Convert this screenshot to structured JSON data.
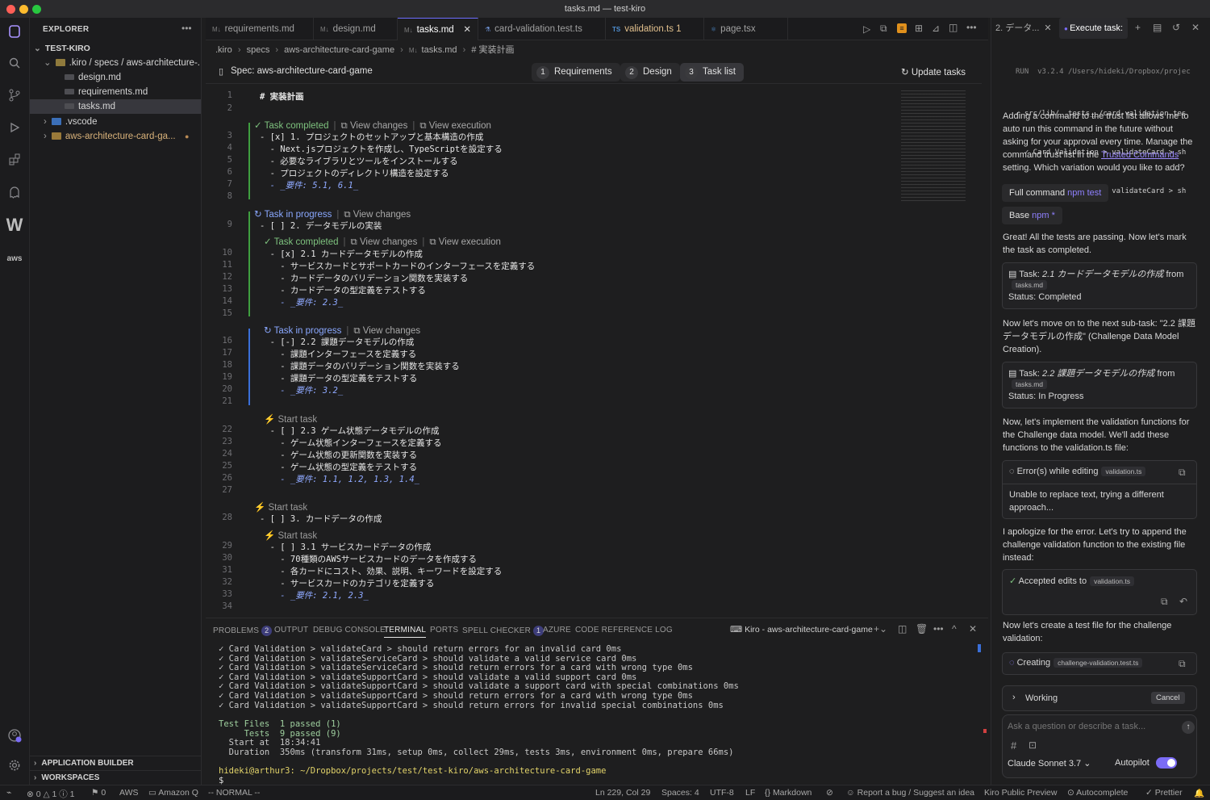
{
  "window": {
    "title": "tasks.md — test-kiro"
  },
  "explorer": {
    "header": "EXPLORER",
    "root": "TEST-KIRO",
    "items": [
      {
        "label": ".kiro / specs / aws-architecture-..."
      },
      {
        "label": "design.md"
      },
      {
        "label": "requirements.md"
      },
      {
        "label": "tasks.md"
      },
      {
        "label": ".vscode"
      },
      {
        "label": "aws-architecture-card-ga..."
      }
    ],
    "sections": [
      "APPLICATION BUILDER",
      "WORKSPACES"
    ]
  },
  "tabs": [
    {
      "label": "requirements.md"
    },
    {
      "label": "design.md"
    },
    {
      "label": "tasks.md"
    },
    {
      "label": "card-validation.test.ts"
    },
    {
      "label": "validation.ts 1"
    },
    {
      "label": "page.tsx"
    }
  ],
  "breadcrumb": [
    ".kiro",
    "specs",
    "aws-architecture-card-game",
    "tasks.md",
    "# 実装計画"
  ],
  "spec": {
    "title": "Spec: aws-architecture-card-game",
    "steps": [
      {
        "n": "1",
        "label": "Requirements"
      },
      {
        "n": "2",
        "label": "Design"
      },
      {
        "n": "3",
        "label": "Task list"
      }
    ],
    "update": "Update tasks"
  },
  "lens": {
    "completed": "Task completed",
    "in_progress": "Task in progress",
    "start": "Start task",
    "view_changes": "View changes",
    "view_execution": "View execution"
  },
  "code": [
    {
      "n": "1",
      "t": "# 実装計画"
    },
    {
      "n": "2",
      "t": ""
    },
    {
      "n": "3",
      "t": "- [x] 1. プロジェクトのセットアップと基本構造の作成"
    },
    {
      "n": "4",
      "t": "  - Next.jsプロジェクトを作成し、TypeScriptを設定する"
    },
    {
      "n": "5",
      "t": "  - 必要なライブラリとツールをインストールする"
    },
    {
      "n": "6",
      "t": "  - プロジェクトのディレクトリ構造を設定する"
    },
    {
      "n": "7",
      "t": "  - _要件: 5.1, 6.1_"
    },
    {
      "n": "8",
      "t": ""
    },
    {
      "n": "9",
      "t": "- [ ] 2. データモデルの実装"
    },
    {
      "n": "10",
      "t": "  - [x] 2.1 カードデータモデルの作成"
    },
    {
      "n": "11",
      "t": "    - サービスカードとサポートカードのインターフェースを定義する"
    },
    {
      "n": "12",
      "t": "    - カードデータのバリデーション関数を実装する"
    },
    {
      "n": "13",
      "t": "    - カードデータの型定義をテストする"
    },
    {
      "n": "14",
      "t": "    - _要件: 2.3_"
    },
    {
      "n": "15",
      "t": ""
    },
    {
      "n": "16",
      "t": "  - [-] 2.2 課題データモデルの作成"
    },
    {
      "n": "17",
      "t": "    - 課題インターフェースを定義する"
    },
    {
      "n": "18",
      "t": "    - 課題データのバリデーション関数を実装する"
    },
    {
      "n": "19",
      "t": "    - 課題データの型定義をテストする"
    },
    {
      "n": "20",
      "t": "    - _要件: 3.2_"
    },
    {
      "n": "21",
      "t": ""
    },
    {
      "n": "22",
      "t": "  - [ ] 2.3 ゲーム状態データモデルの作成"
    },
    {
      "n": "23",
      "t": "    - ゲーム状態インターフェースを定義する"
    },
    {
      "n": "24",
      "t": "    - ゲーム状態の更新関数を実装する"
    },
    {
      "n": "25",
      "t": "    - ゲーム状態の型定義をテストする"
    },
    {
      "n": "26",
      "t": "    - _要件: 1.1, 1.2, 1.3, 1.4_"
    },
    {
      "n": "27",
      "t": ""
    },
    {
      "n": "28",
      "t": "- [ ] 3. カードデータの作成"
    },
    {
      "n": "29",
      "t": "  - [ ] 3.1 サービスカードデータの作成"
    },
    {
      "n": "30",
      "t": "    - 70種類のAWSサービスカードのデータを作成する"
    },
    {
      "n": "31",
      "t": "    - 各カードにコスト、効果、説明、キーワードを設定する"
    },
    {
      "n": "32",
      "t": "    - サービスカードのカテゴリを定義する"
    },
    {
      "n": "33",
      "t": "    - _要件: 2.1, 2.3_"
    },
    {
      "n": "34",
      "t": ""
    }
  ],
  "panel": {
    "tabs": [
      "PROBLEMS",
      "OUTPUT",
      "DEBUG CONSOLE",
      "TERMINAL",
      "PORTS",
      "SPELL CHECKER",
      "AZURE",
      "CODE REFERENCE LOG"
    ],
    "problems_count": "2",
    "spell_count": "1",
    "terminal_name": "Kiro - aws-architecture-card-game",
    "lines": [
      "✓ Card Validation > validateCard > should return errors for an invalid card 0ms",
      "✓ Card Validation > validateServiceCard > should validate a valid service card 0ms",
      "✓ Card Validation > validateServiceCard > should return errors for a card with wrong type 0ms",
      "✓ Card Validation > validateSupportCard > should validate a valid support card 0ms",
      "✓ Card Validation > validateSupportCard > should validate a support card with special combinations 0ms",
      "✓ Card Validation > validateSupportCard > should return errors for a card with wrong type 0ms",
      "✓ Card Validation > validateSupportCard > should return errors for invalid special combinations 0ms"
    ],
    "summary": [
      "Test Files  1 passed (1)",
      "     Tests  9 passed (9)",
      "  Start at  18:34:41",
      "  Duration  350ms (transform 31ms, setup 0ms, collect 29ms, tests 3ms, environment 0ms, prepare 66ms)"
    ],
    "prompt": "hideki@arthur3: ~/Dropbox/projects/test/test-kiro/aws-architecture-card-game",
    "cursor": "$ "
  },
  "chat": {
    "tabs": [
      "2. データ...",
      "Execute task:"
    ],
    "top_lines": [
      "RUN  v3.2.4 /Users/hideki/Dropbox/projec",
      "✓ src/lib/__tests__/card-validation.tes",
      "  ✓ Card Validation > validateCard > sh",
      "  ✓ Card Validation > validateCard > sh"
    ],
    "p1": "Adding a command to the trust list allows me to auto run this command in the future without asking for your approval every time. Manage the command trust list in the",
    "p1_link": "Trusted Commands",
    "p1_tail": "setting. Which variation would you like to add?",
    "full_label": "Full command",
    "full_value": "npm test",
    "base_label": "Base",
    "base_value": "npm *",
    "p2": "Great! All the tests are passing. Now let's mark the task as completed.",
    "task1": {
      "prefix": "Task:",
      "name": "2.1 カードデータモデルの作成",
      "from": "from",
      "file": "tasks.md",
      "status": "Status: Completed"
    },
    "p3": "Now let's move on to the next sub-task: \"2.2 課題データモデルの作成\" (Challenge Data Model Creation).",
    "task2": {
      "prefix": "Task:",
      "name": "2.2 課題データモデルの作成",
      "from": "from",
      "file": "tasks.md",
      "status": "Status: In Progress"
    },
    "p4": "Now, let's implement the validation functions for the Challenge data model. We'll add these functions to the validation.ts file:",
    "err": {
      "label": "Error(s) while editing",
      "file": "validation.ts",
      "msg": "Unable to replace text, trying a different approach..."
    },
    "p5": "I apologize for the error. Let's try to append the challenge validation function to the existing file instead:",
    "accepted": {
      "label": "Accepted edits to",
      "file": "validation.ts"
    },
    "p6": "Now let's create a test file for the challenge validation:",
    "creating": {
      "label": "Creating",
      "file": "challenge-validation.test.ts"
    },
    "working": "Working",
    "cancel": "Cancel",
    "input_placeholder": "Ask a question or describe a task...",
    "model": "Claude Sonnet 3.7",
    "autopilot": "Autopilot"
  },
  "status": {
    "errors": "0",
    "warnings": "1",
    "info": "1",
    "ports": "0",
    "aws": "AWS",
    "amazonq": "Amazon Q",
    "mode": "-- NORMAL --",
    "position": "Ln 229, Col 29",
    "spaces": "Spaces: 4",
    "encoding": "UTF-8",
    "eol": "LF",
    "language": "Markdown",
    "report": "Report a bug / Suggest an idea",
    "preview": "Kiro Public Preview",
    "autocomplete": "Autocomplete",
    "prettier": "Prettier"
  },
  "colors": {
    "accent": "#7b6cf6",
    "success": "#7ec27e",
    "progress": "#8aa8ff"
  }
}
